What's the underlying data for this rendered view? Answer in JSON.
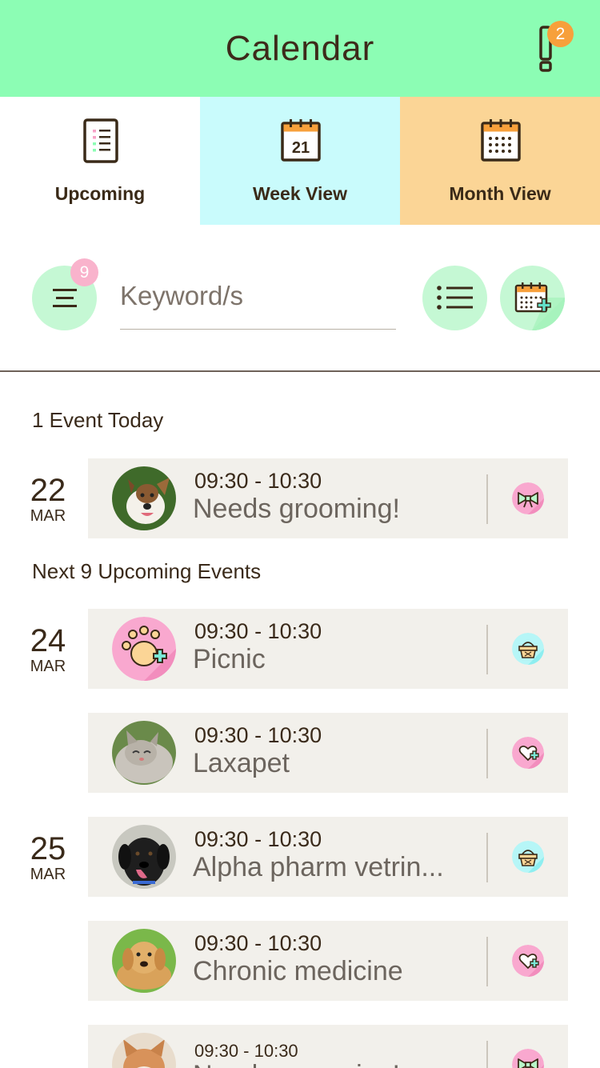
{
  "header": {
    "title": "Calendar",
    "alert_count": "2"
  },
  "tabs": [
    {
      "label": "Upcoming",
      "icon": "list-icon",
      "bg": "#ffffff"
    },
    {
      "label": "Week View",
      "icon": "calendar-21-icon",
      "bg": "#c9fbfc",
      "date": "21"
    },
    {
      "label": "Month View",
      "icon": "calendar-grid-icon",
      "bg": "#fbd596"
    }
  ],
  "toolbar": {
    "filter_count": "9",
    "search_placeholder": "Keyword/s"
  },
  "sections": [
    {
      "title": "1 Event Today"
    },
    {
      "title": "Next 9 Upcoming Events"
    }
  ],
  "dates": [
    {
      "day": "22",
      "month": "MAR"
    },
    {
      "day": "24",
      "month": "MAR"
    },
    {
      "day": "25",
      "month": "MAR"
    }
  ],
  "events": [
    {
      "time": "09:30 - 10:30",
      "title": "Needs grooming!",
      "type_icon": "bow-icon",
      "avatar": "dog-photo"
    },
    {
      "time": "09:30 - 10:30",
      "title": "Picnic",
      "type_icon": "picnic-basket-icon",
      "avatar": "paw-add-icon"
    },
    {
      "time": "09:30 - 10:30",
      "title": "Laxapet",
      "type_icon": "heart-plus-icon",
      "avatar": "cat-photo"
    },
    {
      "time": "09:30 - 10:30",
      "title": "Alpha pharm vetrin...",
      "type_icon": "picnic-basket-icon",
      "avatar": "dog-photo"
    },
    {
      "time": "09:30 - 10:30",
      "title": "Chronic medicine",
      "type_icon": "heart-plus-icon",
      "avatar": "dog-photo"
    },
    {
      "time": "09:30 - 10:30",
      "title": "Needs grooming!",
      "type_icon": "bow-icon",
      "avatar": "cat-photo"
    }
  ],
  "colors": {
    "header_bg": "#8cfdb4",
    "accent_orange": "#f7a03b",
    "badge_pink": "#f9b3cc",
    "button_green": "#c5f8d4",
    "card_bg": "#f2f0eb"
  }
}
